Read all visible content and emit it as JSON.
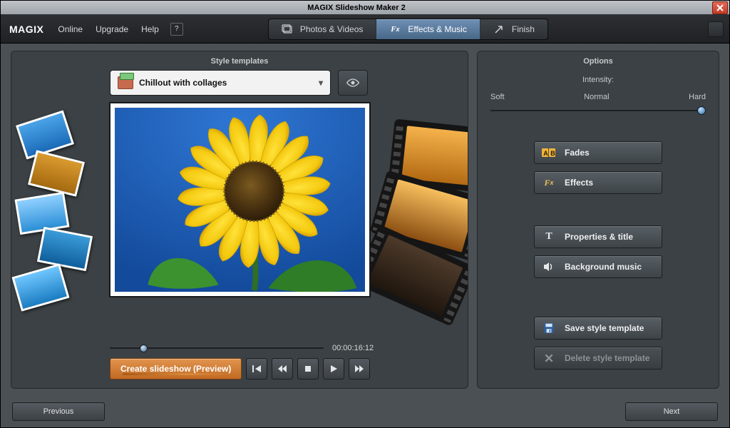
{
  "window": {
    "title": "MAGIX Slideshow Maker 2"
  },
  "brand": "MAGIX",
  "menu": {
    "online": "Online",
    "upgrade": "Upgrade",
    "help": "Help"
  },
  "wizard": {
    "photos": "Photos & Videos",
    "effects": "Effects & Music",
    "finish": "Finish"
  },
  "left": {
    "heading": "Style templates",
    "template_selected": "Chillout with collages",
    "timecode": "00:00:16:12",
    "create_preview": "Create slideshow (Preview)"
  },
  "right": {
    "heading": "Options",
    "intensity": "Intensity:",
    "soft": "Soft",
    "normal": "Normal",
    "hard": "Hard",
    "fades": "Fades",
    "effects": "Effects",
    "properties": "Properties & title",
    "bgmusic": "Background music",
    "save": "Save style template",
    "delete": "Delete style template"
  },
  "footer": {
    "prev": "Previous",
    "next": "Next"
  }
}
